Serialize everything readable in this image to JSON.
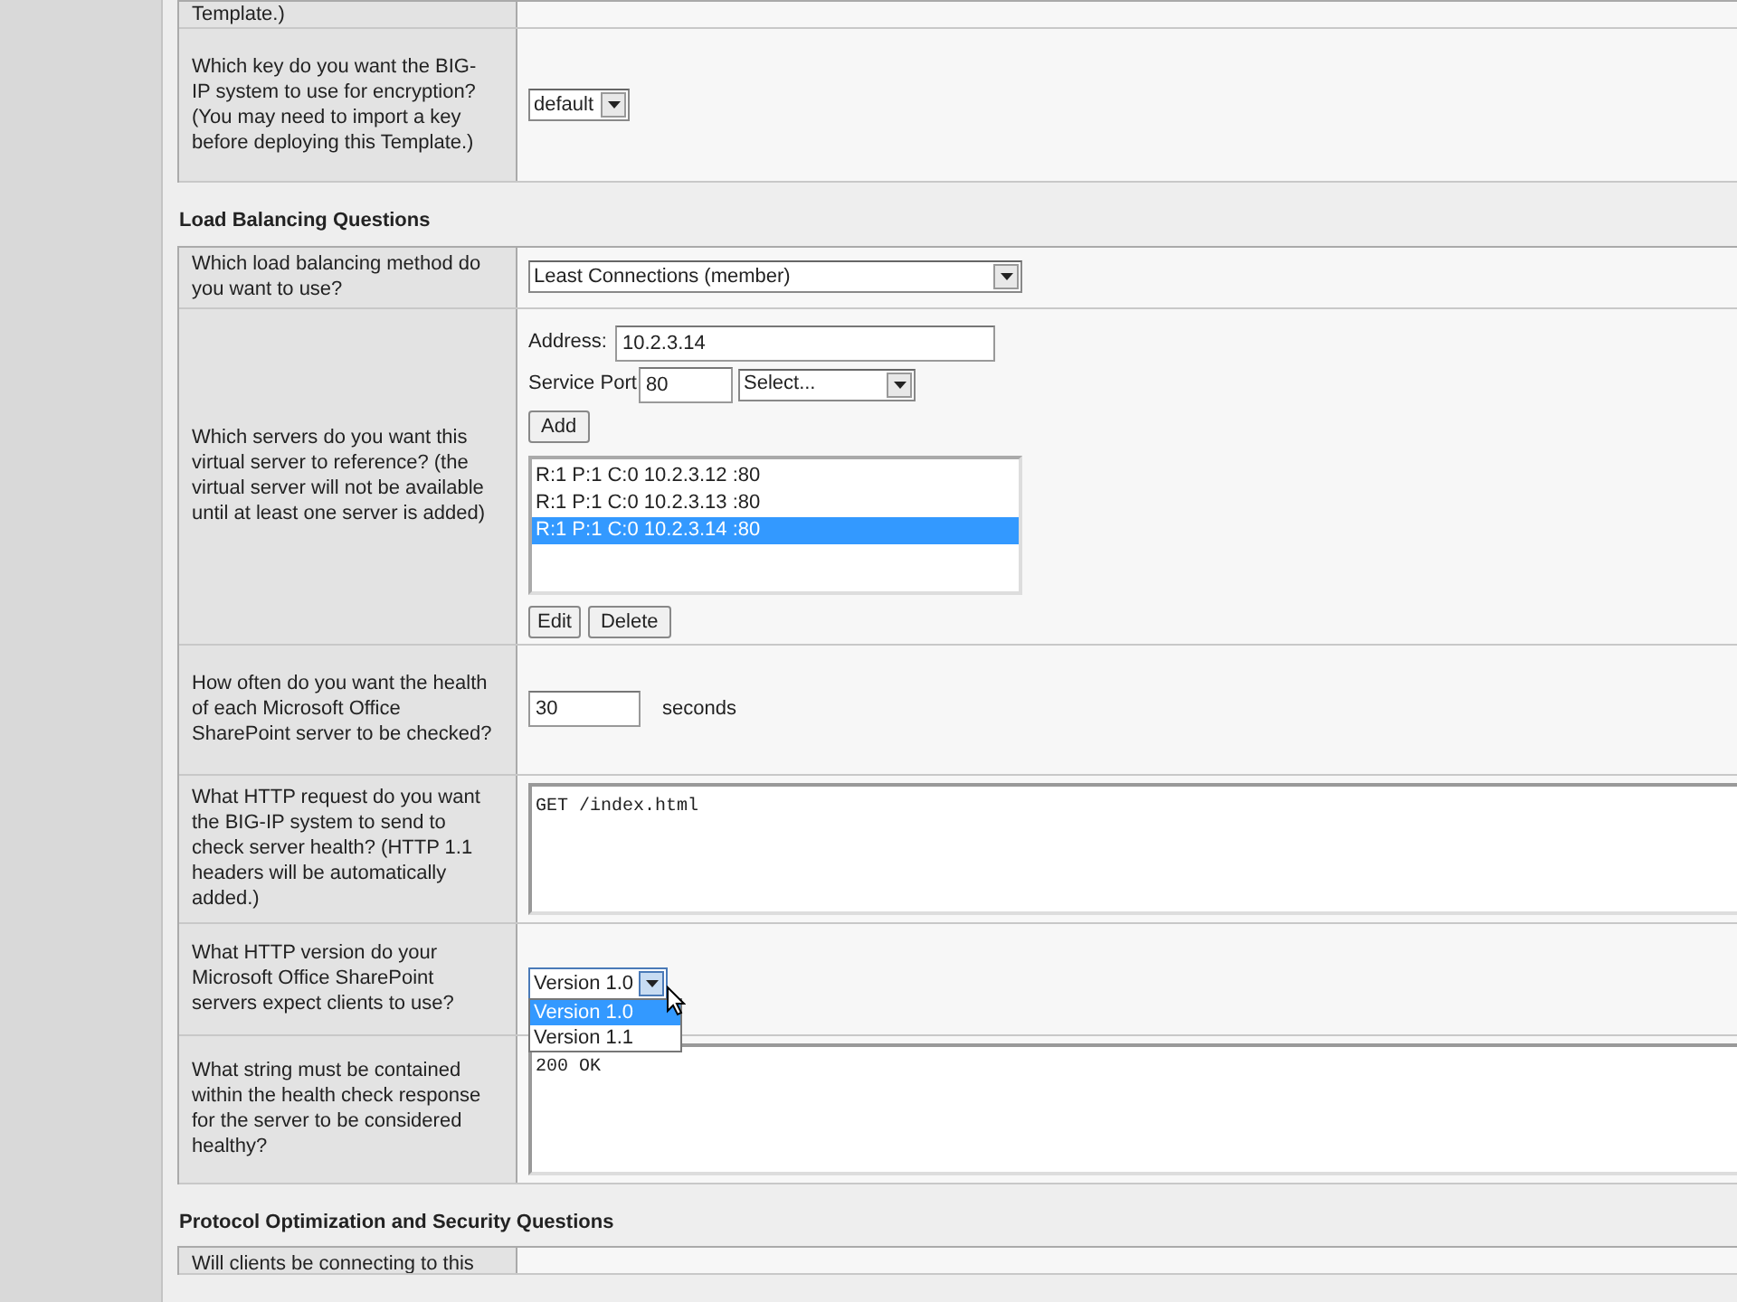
{
  "sections": [
    {
      "rows": [
        {
          "kind": "cut",
          "label": "Template.)"
        },
        {
          "kind": "select",
          "label": "Which key do you want the BIG-IP system to use for encryption? (You may need to import a key before deploying this Template.)",
          "value": "default",
          "wide": false
        }
      ]
    },
    {
      "heading": "Load Balancing Questions",
      "rows": [
        {
          "kind": "select",
          "label": "Which load balancing method do you want to use?",
          "value": "Least Connections (member)",
          "wide": true
        },
        {
          "kind": "servers",
          "label": "Which servers do you want this virtual server to reference? (the virtual server will not be available until at least one server is added)",
          "address_label": "Address:",
          "address": "10.2.3.14",
          "port_label": "Service Port",
          "port": "80",
          "port_select": "Select...",
          "add": "Add",
          "members": [
            {
              "text": "R:1 P:1 C:0 10.2.3.12 :80",
              "selected": false
            },
            {
              "text": "R:1 P:1 C:0 10.2.3.13 :80",
              "selected": false
            },
            {
              "text": "R:1 P:1 C:0 10.2.3.14 :80",
              "selected": true
            }
          ],
          "edit": "Edit",
          "delete": "Delete"
        },
        {
          "kind": "interval",
          "label": "How often do you want the health of each Microsoft Office SharePoint server to be checked?",
          "value": "30",
          "unit": "seconds"
        },
        {
          "kind": "textarea",
          "label": "What HTTP request do you want the BIG-IP system to send to check server health? (HTTP 1.1 headers will be automatically added.)",
          "value": "GET /index.html"
        },
        {
          "kind": "open-select",
          "label": "What HTTP version do your Microsoft Office SharePoint servers expect clients to use?",
          "value": "Version 1.0",
          "options": [
            {
              "text": "Version 1.0",
              "selected": true
            },
            {
              "text": "Version 1.1",
              "selected": false
            }
          ]
        },
        {
          "kind": "textarea",
          "label": "What string must be contained within the health check response for the server to be considered healthy?",
          "value": "200 OK"
        }
      ]
    },
    {
      "heading": "Protocol Optimization and Security Questions",
      "rows": [
        {
          "kind": "cut-bottom",
          "label": "Will clients be connecting to this"
        }
      ]
    }
  ]
}
